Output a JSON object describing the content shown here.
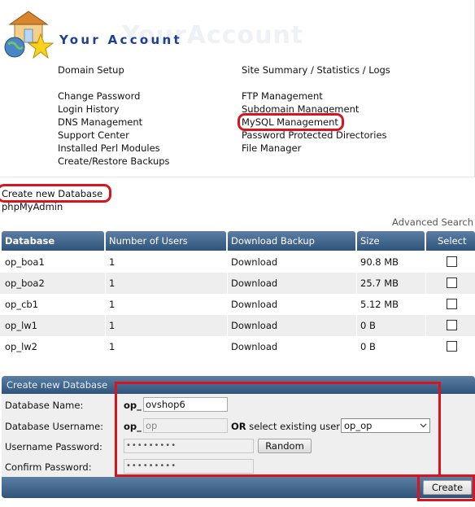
{
  "header": {
    "title": "Your Account",
    "title_ghost": "YourAccount",
    "left_links": [
      "Domain Setup",
      "Change Password",
      "Login History",
      "DNS Management",
      "Support Center",
      "Installed Perl Modules",
      "Create/Restore Backups"
    ],
    "right_links": [
      "Site Summary / Statistics / Logs",
      "FTP Management",
      "Subdomain Management",
      "MySQL Management",
      "Password Protected Directories",
      "File Manager"
    ]
  },
  "sub_links": {
    "create_db": "Create new Database",
    "phpmyadmin": "phpMyAdmin",
    "advanced_search": "Advanced Search"
  },
  "table": {
    "columns": [
      "Database",
      "Number of Users",
      "Download Backup",
      "Size",
      "Select"
    ],
    "rows": [
      {
        "name": "op_boa1",
        "users": "1",
        "backup": "Download",
        "size": "90.8 MB"
      },
      {
        "name": "op_boa2",
        "users": "1",
        "backup": "Download",
        "size": "25.7 MB"
      },
      {
        "name": "op_cb1",
        "users": "1",
        "backup": "Download",
        "size": "5.12 MB"
      },
      {
        "name": "op_lw1",
        "users": "1",
        "backup": "Download",
        "size": "0 B"
      },
      {
        "name": "op_lw2",
        "users": "1",
        "backup": "Download",
        "size": "0 B"
      }
    ]
  },
  "form": {
    "heading": "Create new Database",
    "db_name_label": "Database Name:",
    "db_prefix": "op_",
    "db_name_value": "ovshop6",
    "db_user_label": "Database Username:",
    "user_prefix": "op_",
    "user_placeholder": "op",
    "or_text": "OR",
    "select_existing_text": "select existing user",
    "existing_user_value": "op_op",
    "password_label": "Username Password:",
    "password_value": "•••••••••",
    "random_button": "Random",
    "confirm_label": "Confirm Password:",
    "confirm_value": "•••••••••",
    "create_button": "Create"
  },
  "colors": {
    "accent": "#1f3f8f",
    "header_bar": "#3b5f86",
    "highlight": "#d9141e"
  }
}
